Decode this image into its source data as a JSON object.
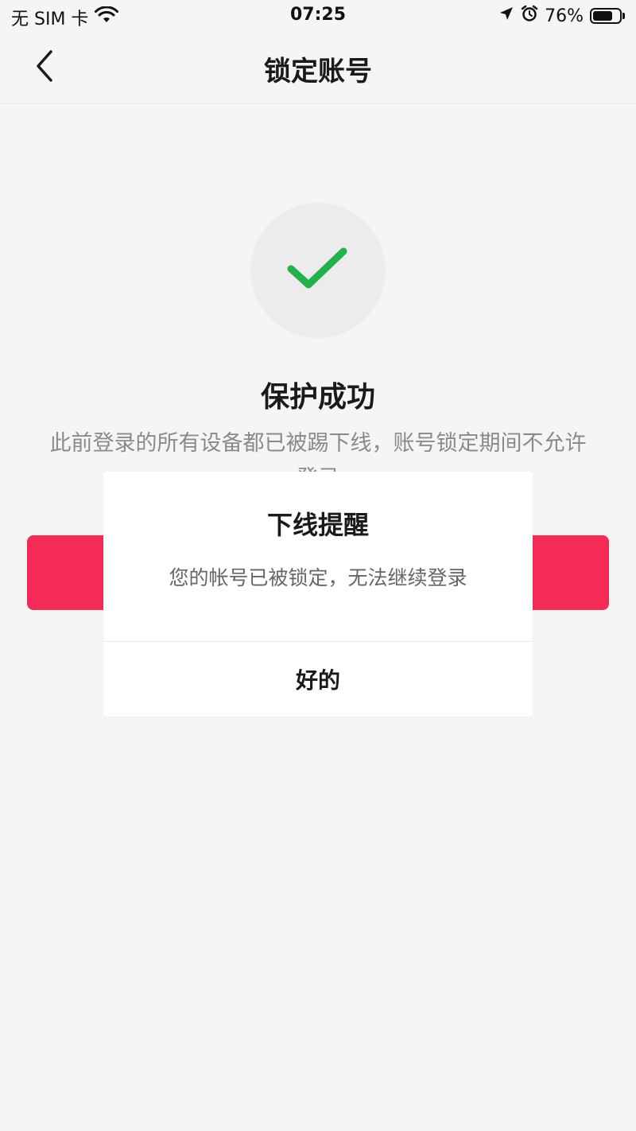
{
  "status_bar": {
    "carrier": "无 SIM 卡",
    "time": "07:25",
    "battery_percent": "76%",
    "battery_level": 0.76,
    "icons": [
      "wifi-icon",
      "location-arrow-icon",
      "alarm-icon",
      "battery-icon"
    ]
  },
  "nav": {
    "title": "锁定账号",
    "back_icon": "chevron-left-icon"
  },
  "success": {
    "icon": "checkmark-icon",
    "icon_color": "#22b14c",
    "title": "保护成功",
    "description": "此前登录的所有设备都已被踢下线，账号锁定期间不允许登录"
  },
  "primary_button": {
    "color": "#f42b56"
  },
  "modal": {
    "title": "下线提醒",
    "message": "您的帐号已被锁定，无法继续登录",
    "ok_label": "好的"
  }
}
